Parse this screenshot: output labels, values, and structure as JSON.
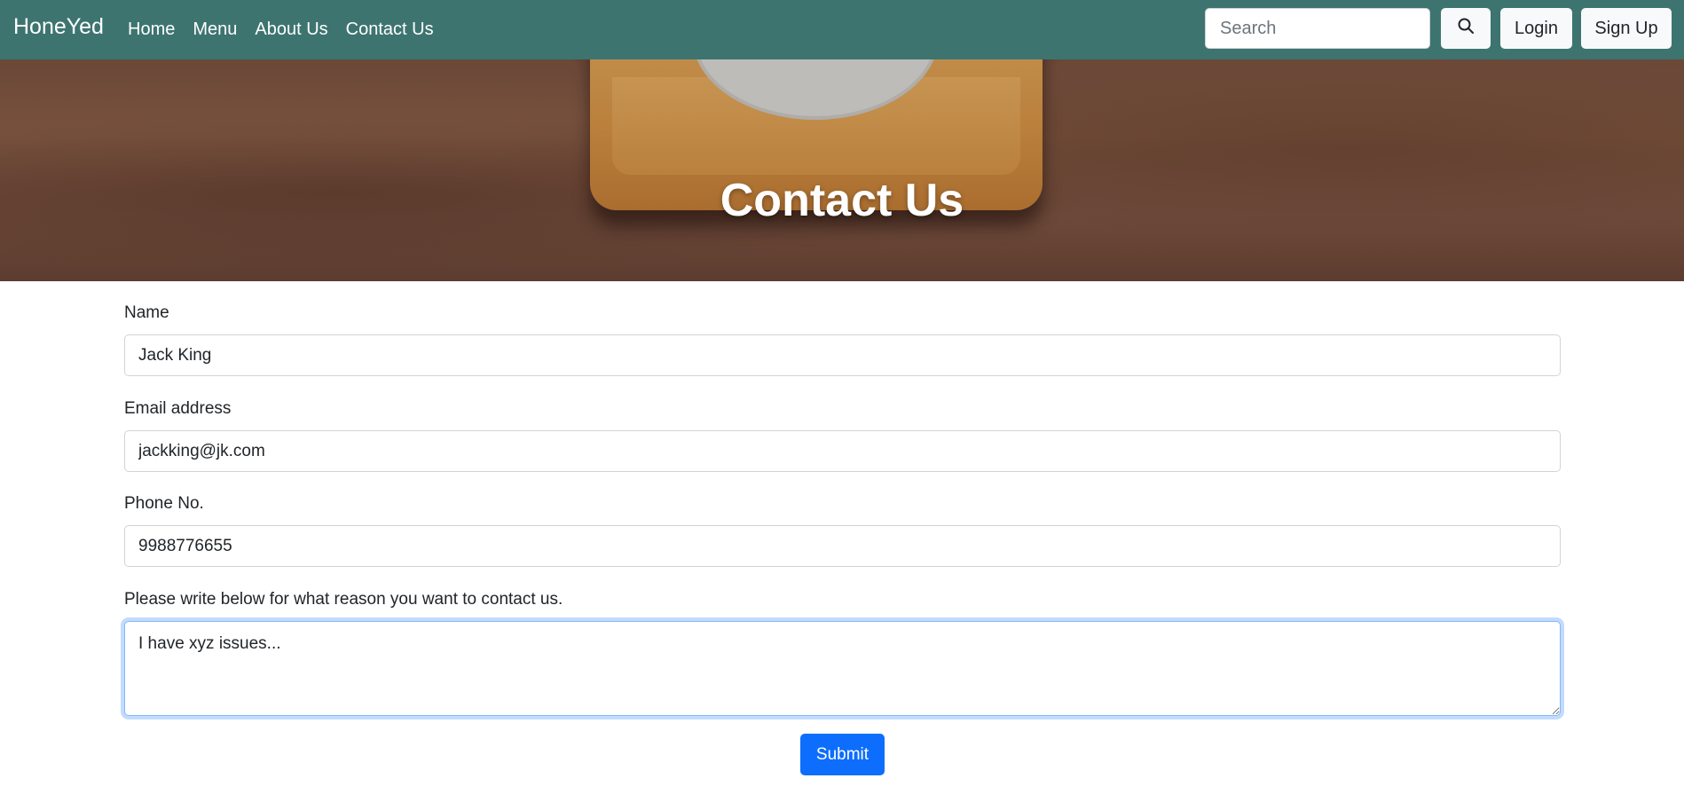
{
  "navbar": {
    "brand": "HoneYed",
    "links": [
      "Home",
      "Menu",
      "About Us",
      "Contact Us"
    ],
    "search_placeholder": "Search",
    "login_label": "Login",
    "signup_label": "Sign Up",
    "color": "#3d7470"
  },
  "hero": {
    "title": "Contact Us"
  },
  "form": {
    "name_label": "Name",
    "name_value": "Jack King",
    "email_label": "Email address",
    "email_value": "jackking@jk.com",
    "phone_label": "Phone No.",
    "phone_value": "9988776655",
    "reason_label": "Please write below for what reason you want to contact us.",
    "reason_value": "I have xyz issues...",
    "submit_label": "Submit",
    "submit_color": "#0d6efd"
  }
}
